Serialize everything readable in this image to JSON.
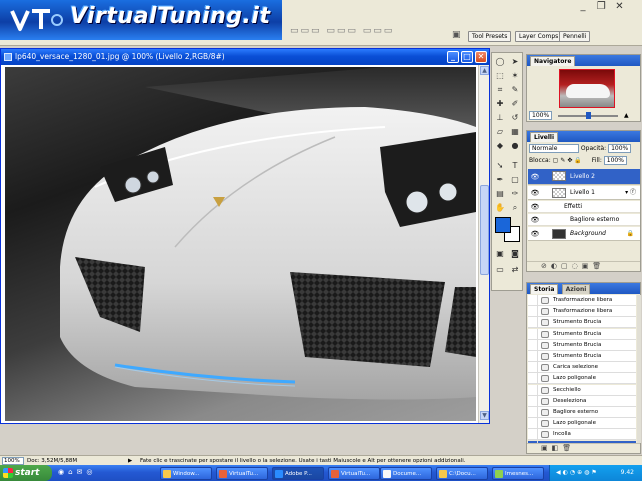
{
  "banner": {
    "title": "VirtualTuning.it"
  },
  "options_bar": {
    "palette_tabs": [
      "Tool Presets",
      "Layer Comps",
      "Pennelli"
    ]
  },
  "document": {
    "title": "lp640_versace_1280_01.jpg @ 100% (Livello 2,RGB/8#)"
  },
  "navigator": {
    "title": "Navigatore",
    "zoom": "100%"
  },
  "layers": {
    "title": "Livelli",
    "blend_mode": "Normale",
    "opacity_label": "Opacità:",
    "opacity_value": "100%",
    "lock_label": "Blocca:",
    "fill_label": "Fill:",
    "fill_value": "100%",
    "rows": [
      {
        "name": "Livello 2"
      },
      {
        "name": "Livello 1"
      },
      {
        "name": "Effetti"
      },
      {
        "name": "Bagliore esterno"
      },
      {
        "name": "Background"
      }
    ]
  },
  "history": {
    "tabs": [
      "Storia",
      "Azioni"
    ],
    "items": [
      "Trasformazione libera",
      "Trasformazione libera",
      "Strumento Brucia",
      "Strumento Brucia",
      "Strumento Brucia",
      "Strumento Brucia",
      "Carica selezione",
      "Lazo poligonale",
      "Secchiello",
      "Deseleziona",
      "Bagliore esterno",
      "Lazo poligonale",
      "Incolla",
      "Ordine livelli"
    ]
  },
  "statusbar": {
    "zoom": "100%",
    "doc": "Doc: 3,52M/5,88M",
    "hint": "Fate clic e trascinate per spostare il livello o la selezione. Usate i tasti Maiuscole e Alt per ottenere opzioni addizionali."
  },
  "taskbar": {
    "start": "start",
    "buttons": [
      "Window...",
      "VirtualTu...",
      "Adobe P...",
      "VirtualTu...",
      "Docume...",
      "C:\\Docu...",
      "Imesnes..."
    ],
    "clock": "9.42"
  },
  "colors": {
    "foreground_swatch": "#1a66d9",
    "background_swatch": "#ffffff",
    "selection": "#3162c7"
  }
}
